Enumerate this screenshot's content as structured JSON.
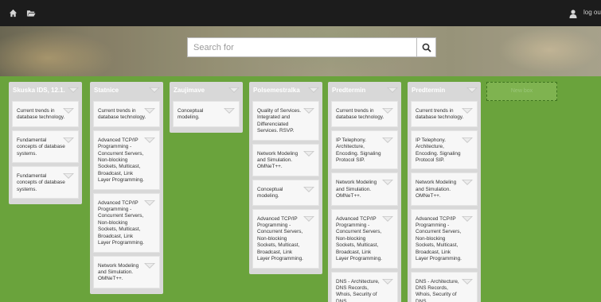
{
  "topbar": {
    "logout_label": "log out",
    "icons": [
      "home-icon",
      "folder-icon",
      "user-icon"
    ]
  },
  "search": {
    "placeholder": "Search for",
    "button_icon": "search-icon"
  },
  "new_box": {
    "label": "New box"
  },
  "lists": [
    {
      "title": "Skuska IDS, 12.1.",
      "cards": [
        "Current trends in database technology.",
        "Fundamental concepts of database systems.",
        "Fundamental concepts of database systems."
      ]
    },
    {
      "title": "Statnice",
      "cards": [
        "Current trends in database technology.",
        "Advanced TCP/IP Programming - Concurrent Servers, Non-blocking Sockets, Multicast, Broadcast, Link Layer Programming.",
        "Advanced TCP/IP Programming - Concurrent Servers, Non-blocking Sockets, Multicast, Broadcast, Link Layer Programming.",
        "Network Modeling and Simulation. OMNeT++."
      ]
    },
    {
      "title": "Zaujimave",
      "cards": [
        "Conceptual modeling."
      ]
    },
    {
      "title": "Polsemestralka",
      "cards": [
        "Quality of Services. Integrated and Differenciated Services. RSVP.",
        "Network Modeling and Simulation. OMNeT++.",
        "Conceptual modeling.",
        "Advanced TCP/IP Programming - Concurrent Servers, Non-blocking Sockets, Multicast, Broadcast, Link Layer Programming."
      ]
    },
    {
      "title": "Predtermin",
      "cards": [
        "Current trends in database technology.",
        "IP Telephony. Architecture, Encoding. Signaling Protocol SIP.",
        "Network Modeling and Simulation. OMNeT++.",
        "Advanced TCP/IP Programming - Concurrent Servers, Non-blocking Sockets, Multicast, Broadcast, Link Layer Programming.",
        "DNS - Architecture, DNS Records, Whois, Security of DNS"
      ]
    },
    {
      "title": "Predtermin",
      "cards": [
        "Current trends in database technology.",
        "IP Telephony. Architecture, Encoding. Signaling Protocol SIP.",
        "Network Modeling and Simulation. OMNeT++.",
        "Advanced TCP/IP Programming - Concurrent Servers, Non-blocking Sockets, Multicast, Broadcast, Link Layer Programming.",
        "DNS - Architecture, DNS Records, Whois, Security of DNS"
      ]
    }
  ]
}
